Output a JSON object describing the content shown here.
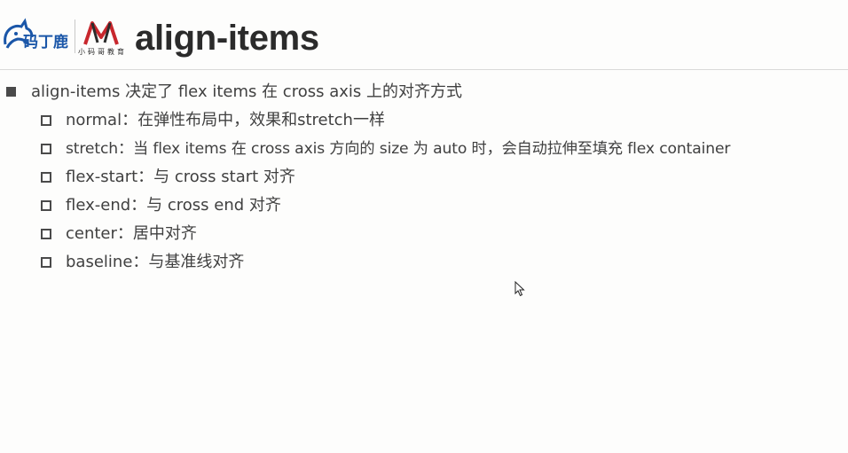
{
  "slide": {
    "title": "align-items",
    "logos": {
      "brand_left_text": "码丁鹿",
      "brand_right_text": "小码哥教育"
    },
    "main_point": "align-items 决定了 flex items 在 cross axis 上的对齐方式",
    "sub_points": [
      "normal：在弹性布局中，效果和stretch一样",
      "stretch：当 flex items 在 cross axis 方向的 size 为 auto 时，会自动拉伸至填充 flex container",
      "flex-start：与 cross start 对齐",
      "flex-end：与 cross end 对齐",
      "center：居中对齐",
      "baseline：与基准线对齐"
    ]
  },
  "colors": {
    "background": "#fdfdfc",
    "text": "#404040",
    "title": "#2b2b2b",
    "logo_blue": "#1a56a8",
    "logo_red": "#c8272d"
  },
  "icons": {
    "main_bullet": "filled-square",
    "sub_bullet": "hollow-square",
    "cursor": "mouse-pointer-arrow"
  }
}
